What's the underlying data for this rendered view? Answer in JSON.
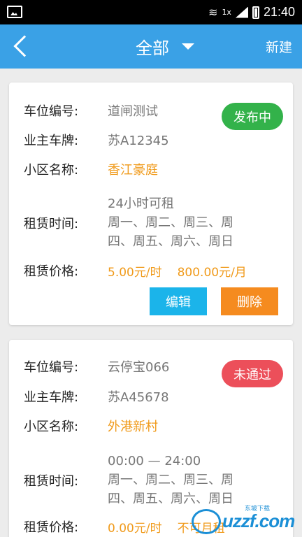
{
  "status_bar": {
    "time": "21:40",
    "network_label": "1x",
    "icons": [
      "image-icon",
      "wifi-icon",
      "signal-icon",
      "battery-icon"
    ]
  },
  "app_bar": {
    "title": "全部",
    "new_label": "新建"
  },
  "cards": [
    {
      "spot_label": "车位编号:",
      "spot_value": "道闸测试",
      "plate_label": "业主车牌:",
      "plate_value": "苏A12345",
      "community_label": "小区名称:",
      "community_value": "香江豪庭",
      "time_label": "租赁时间:",
      "time_line1": "24小时可租",
      "time_line2": "周一、周二、周三、周",
      "time_line3": "四、周五、周六、周日",
      "price_label": "租赁价格:",
      "price_hour": "5.00元/时",
      "price_month": "800.00元/月",
      "status": "发布中",
      "edit_label": "编辑",
      "delete_label": "删除"
    },
    {
      "spot_label": "车位编号:",
      "spot_value": "云停宝066",
      "plate_label": "业主车牌:",
      "plate_value": "苏A45678",
      "community_label": "小区名称:",
      "community_value": "外港新村",
      "time_label": "租赁时间:",
      "time_line1": "00:00 — 24:00",
      "time_line2": "周一、周二、周三、周",
      "time_line3": "四、周五、周六、周日",
      "price_label": "租赁价格:",
      "price_hour": "0.00元/时",
      "price_month": "不可月租",
      "status": "未通过"
    }
  ],
  "watermark": {
    "text": "uzzf.com",
    "small": "东坡下载"
  },
  "colors": {
    "app_bar": "#3aa1e6",
    "status_published": "#33b24a",
    "status_rejected": "#ec4f5a",
    "edit_button": "#1bb4ea",
    "delete_button": "#f58b1f",
    "highlight_text": "#f09a1a"
  }
}
